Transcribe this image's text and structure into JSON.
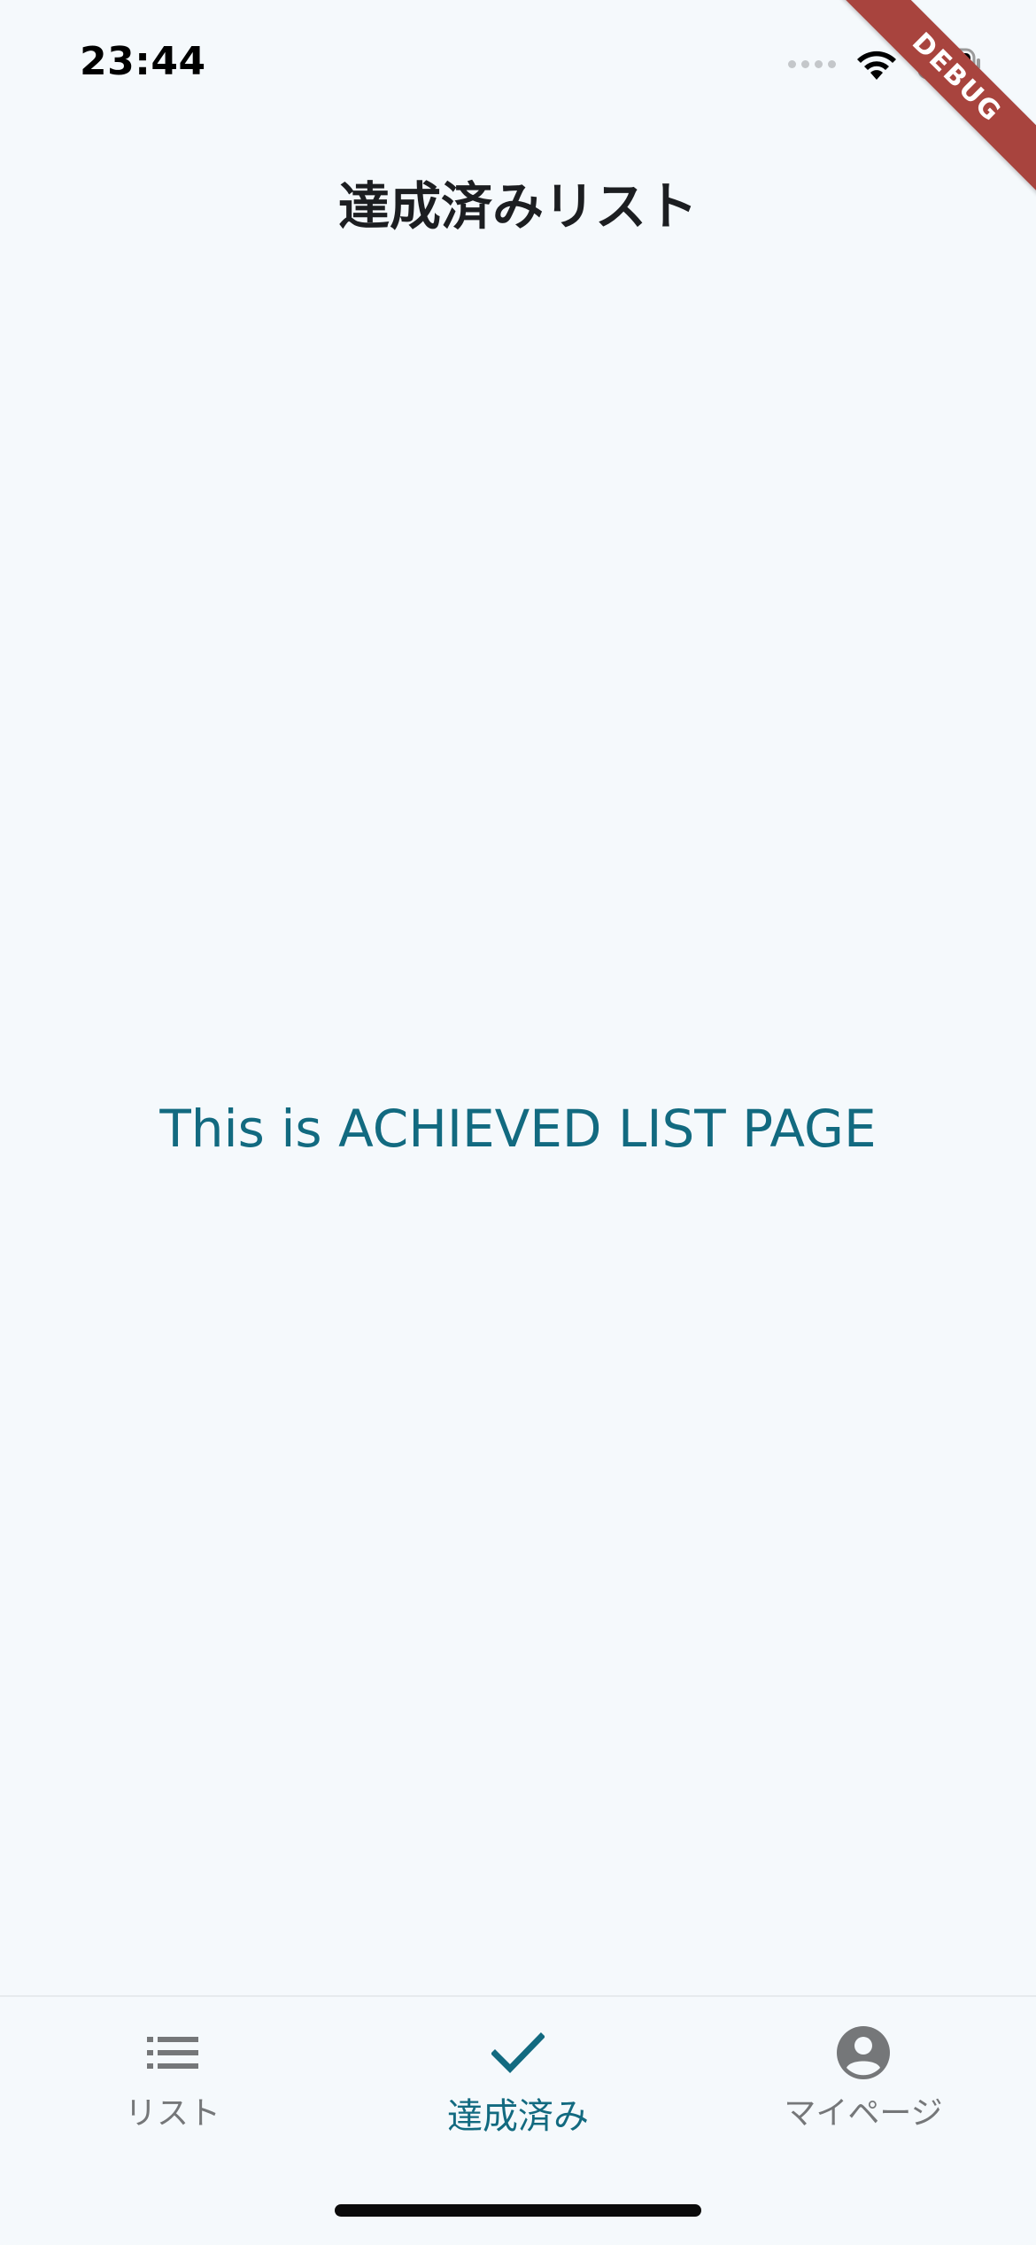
{
  "status_bar": {
    "time": "23:44"
  },
  "debug_banner": "DEBUG",
  "header": {
    "title": "達成済みリスト"
  },
  "main": {
    "message": "This is ACHIEVED LIST PAGE"
  },
  "bottom_nav": {
    "items": [
      {
        "label": "リスト",
        "icon": "list-icon",
        "active": false
      },
      {
        "label": "達成済み",
        "icon": "check-icon",
        "active": true
      },
      {
        "label": "マイページ",
        "icon": "account-circle-icon",
        "active": false
      }
    ]
  },
  "colors": {
    "background": "#f5f9fc",
    "accent": "#126a80",
    "inactive": "#757779",
    "debug_ribbon": "#a8443e"
  }
}
